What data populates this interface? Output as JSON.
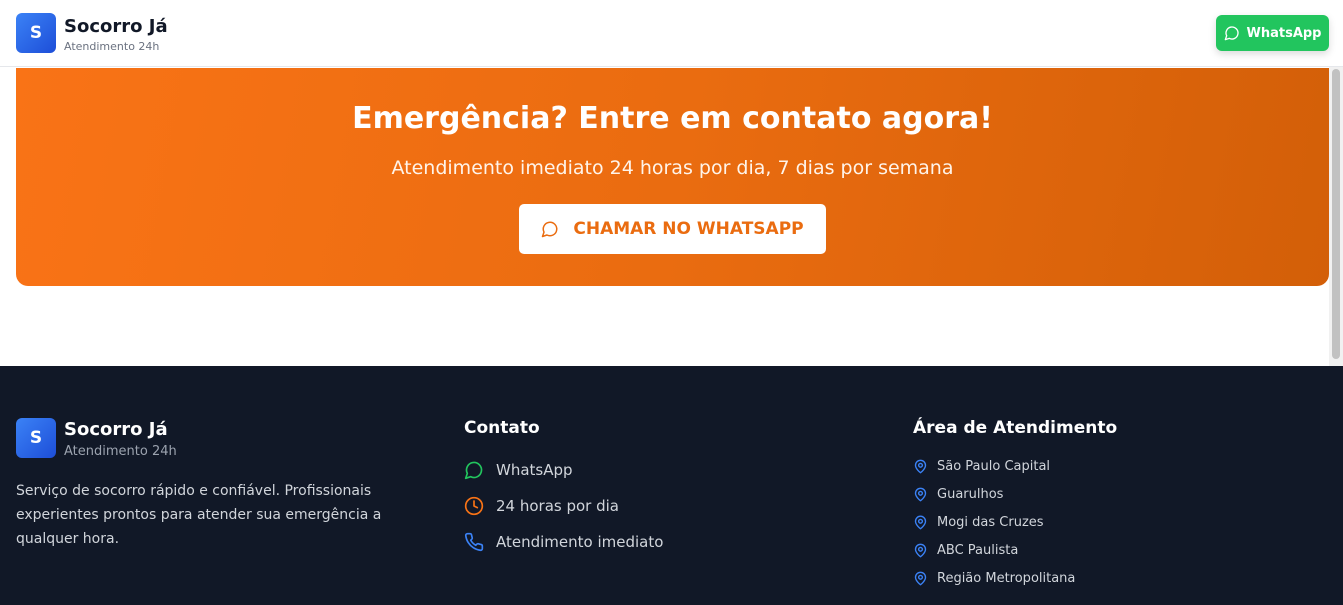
{
  "header": {
    "logo_letter": "S",
    "brand_name": "Socorro Já",
    "brand_tagline": "Atendimento 24h",
    "whatsapp_label": "WhatsApp"
  },
  "cta": {
    "title": "Emergência? Entre em contato agora!",
    "subtitle": "Atendimento imediato 24 horas por dia, 7 dias por semana",
    "button_label": "CHAMAR NO WHATSAPP"
  },
  "footer": {
    "logo_letter": "S",
    "brand_name": "Socorro Já",
    "brand_tagline": "Atendimento 24h",
    "description": "Serviço de socorro rápido e confiável. Profissionais experientes prontos para atender sua emergência a qualquer hora.",
    "contact": {
      "title": "Contato",
      "items": [
        {
          "label": "WhatsApp",
          "icon": "message-circle-icon"
        },
        {
          "label": "24 horas por dia",
          "icon": "clock-icon"
        },
        {
          "label": "Atendimento imediato",
          "icon": "phone-icon"
        }
      ]
    },
    "area": {
      "title": "Área de Atendimento",
      "items": [
        "São Paulo Capital",
        "Guarulhos",
        "Mogi das Cruzes",
        "ABC Paulista",
        "Região Metropolitana"
      ]
    }
  },
  "colors": {
    "brand_blue": "#2563eb",
    "whatsapp_green": "#22c55e",
    "cta_orange": "#f97316",
    "footer_bg": "#111827"
  }
}
